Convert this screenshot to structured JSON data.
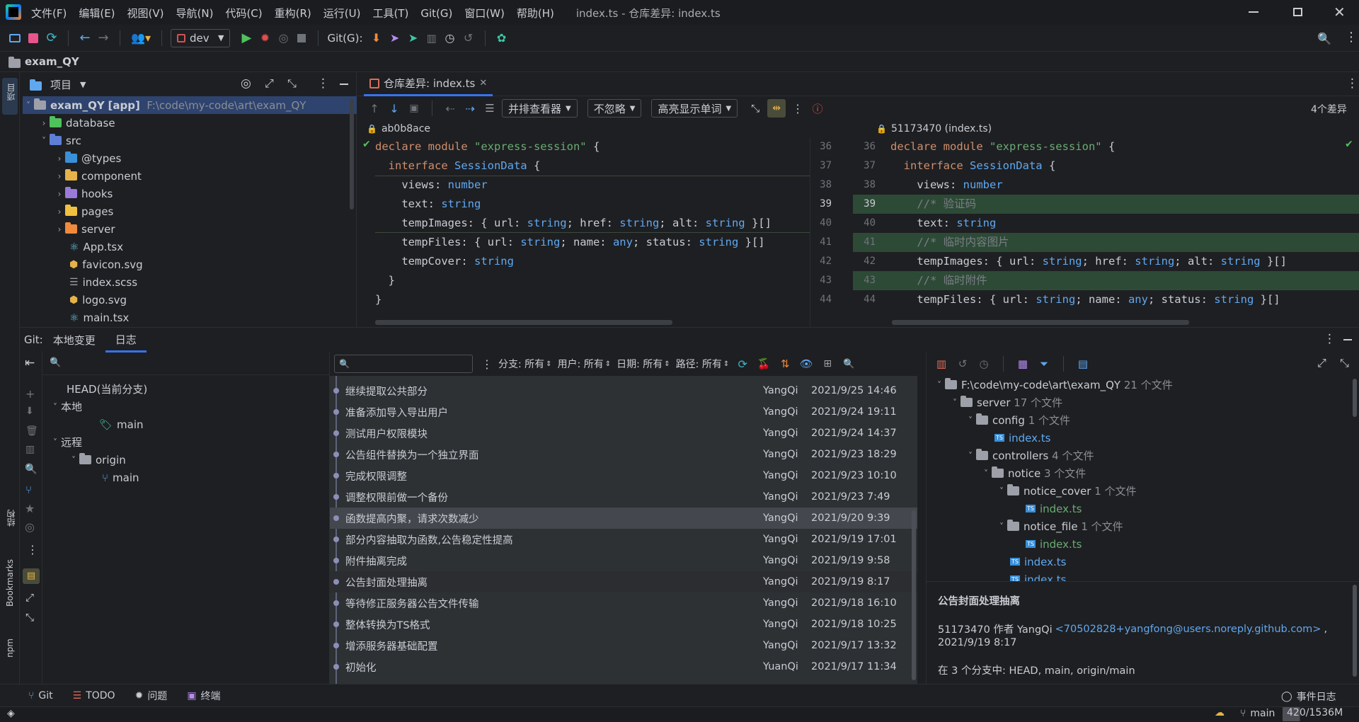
{
  "titlebar": {
    "menus": [
      "文件(F)",
      "编辑(E)",
      "视图(V)",
      "导航(N)",
      "代码(C)",
      "重构(R)",
      "运行(U)",
      "工具(T)",
      "Git(G)",
      "窗口(W)",
      "帮助(H)"
    ],
    "title": "index.ts - 仓库差异: index.ts"
  },
  "toolbar": {
    "branch": "dev",
    "git_label": "Git(G):"
  },
  "breadcrumb": {
    "project": "exam_QY"
  },
  "leftstrip": {
    "project_label": "项目",
    "structure_label": "结构",
    "bookmarks_label": "Bookmarks",
    "npm_label": "npm"
  },
  "project_panel": {
    "title": "项目",
    "root_name": "exam_QY",
    "root_tag": "[app]",
    "root_path": "F:\\code\\my-code\\art\\exam_QY",
    "items": [
      {
        "name": "database"
      },
      {
        "name": "src"
      },
      {
        "name": "@types"
      },
      {
        "name": "component"
      },
      {
        "name": "hooks"
      },
      {
        "name": "pages"
      },
      {
        "name": "server"
      },
      {
        "name": "App.tsx"
      },
      {
        "name": "favicon.svg"
      },
      {
        "name": "index.scss"
      },
      {
        "name": "logo.svg"
      },
      {
        "name": "main.tsx"
      }
    ]
  },
  "diff": {
    "tab_title": "仓库差异: index.ts",
    "viewer": "并排查看器",
    "ignore": "不忽略",
    "highlight": "高亮显示单词",
    "diff_count": "4个差异",
    "left_rev": "ab0b8ace",
    "right_rev": "51173470 (index.ts)",
    "left_lines": {
      "l1a": "declare module ",
      "l1b": "\"express-session\"",
      "l1c": " {",
      "l2a": "  interface ",
      "l2b": "SessionData",
      "l2c": " {",
      "l3a": "    views: ",
      "l3b": "number",
      "l4a": "    text: ",
      "l4b": "string",
      "l5a": "    tempImages: { url: ",
      "l5b": "string",
      "l5c": "; href: ",
      "l5d": "string",
      "l5e": "; alt: ",
      "l5f": "string",
      "l5g": " }[]",
      "l6a": "    tempFiles: { url: ",
      "l6b": "string",
      "l6c": "; name: ",
      "l6d": "any",
      "l6e": "; status: ",
      "l6f": "string",
      "l6g": " }[]",
      "l7a": "    tempCover: ",
      "l7b": "string",
      "l8": "  }",
      "l9": "}"
    },
    "right_lines": {
      "r1a": "declare module ",
      "r1b": "\"express-session\"",
      "r1c": " {",
      "r2a": "  interface ",
      "r2b": "SessionData",
      "r2c": " {",
      "r3a": "    views: ",
      "r3b": "number",
      "r4": "    //* 验证码",
      "r5a": "    text: ",
      "r5b": "string",
      "r6": "    //* 临时内容图片",
      "r7a": "    tempImages: { url: ",
      "r7b": "string",
      "r7c": "; href: ",
      "r7d": "string",
      "r7e": "; alt: ",
      "r7f": "string",
      "r7g": " }[]",
      "r8": "    //* 临时附件",
      "r9a": "    tempFiles: { url: ",
      "r9b": "string",
      "r9c": "; name: ",
      "r9d": "any",
      "r9e": "; status: ",
      "r9f": "string",
      "r9g": " }[]"
    },
    "left_nums": [
      "36",
      "37",
      "38",
      "39",
      "40",
      "41",
      "42",
      "43",
      "44"
    ],
    "right_nums": [
      "36",
      "37",
      "38",
      "39",
      "40",
      "41",
      "42",
      "43",
      "44"
    ]
  },
  "git": {
    "label": "Git:",
    "tab_local": "本地变更",
    "tab_log": "日志",
    "branches": {
      "head": "HEAD(当前分支)",
      "local": "本地",
      "local_main": "main",
      "remote": "远程",
      "origin": "origin",
      "origin_main": "main"
    },
    "filters": {
      "branch": "分支: 所有",
      "user": "用户: 所有",
      "date": "日期: 所有",
      "path": "路径: 所有"
    },
    "commits": [
      {
        "msg": "继续提取公共部分",
        "author": "YangQi",
        "date": "2021/9/25 14:46"
      },
      {
        "msg": "准备添加导入导出用户",
        "author": "YangQi",
        "date": "2021/9/24 19:11"
      },
      {
        "msg": "测试用户权限模块",
        "author": "YangQi",
        "date": "2021/9/24 14:37"
      },
      {
        "msg": "公告组件替换为一个独立界面",
        "author": "YangQi",
        "date": "2021/9/23 18:29"
      },
      {
        "msg": "完成权限调整",
        "author": "YangQi",
        "date": "2021/9/23 10:10"
      },
      {
        "msg": "调整权限前做一个备份",
        "author": "YangQi",
        "date": "2021/9/23 7:49"
      },
      {
        "msg": "函数提高内聚，请求次数减少",
        "author": "YangQi",
        "date": "2021/9/20 9:39"
      },
      {
        "msg": "部分内容抽取为函数,公告稳定性提高",
        "author": "YangQi",
        "date": "2021/9/19 17:01"
      },
      {
        "msg": "附件抽离完成",
        "author": "YangQi",
        "date": "2021/9/19 9:58"
      },
      {
        "msg": "公告封面处理抽离",
        "author": "YangQi",
        "date": "2021/9/19 8:17"
      },
      {
        "msg": "等待修正服务器公告文件传输",
        "author": "YangQi",
        "date": "2021/9/18 16:10"
      },
      {
        "msg": "整体转换为TS格式",
        "author": "YangQi",
        "date": "2021/9/18 10:25"
      },
      {
        "msg": "增添服务器基础配置",
        "author": "YangQi",
        "date": "2021/9/17 13:32"
      },
      {
        "msg": "初始化",
        "author": "YuanQi",
        "date": "2021/9/17 11:34"
      }
    ],
    "files": {
      "root": "F:\\code\\my-code\\art\\exam_QY",
      "root_count": "21 个文件",
      "server": "server",
      "server_count": "17 个文件",
      "config": "config",
      "config_count": "1 个文件",
      "config_index": "index.ts",
      "controllers": "controllers",
      "controllers_count": "4 个文件",
      "notice": "notice",
      "notice_count": "3 个文件",
      "notice_cover": "notice_cover",
      "notice_cover_count": "1 个文件",
      "nc_index": "index.ts",
      "notice_file": "notice_file",
      "notice_file_count": "1 个文件",
      "nf_index": "index.ts",
      "notice_index": "index.ts",
      "partial": "index.ts"
    },
    "details": {
      "title": "公告封面处理抽离",
      "hash_author": "51173470 作者 YangQi",
      "email": "<70502828+yangfong@users.noreply.github.com>",
      "comma": ",",
      "date": "2021/9/19 8:17",
      "branches": "在 3 个分支中: HEAD, main, origin/main"
    }
  },
  "bottomtools": {
    "git": "Git",
    "todo": "TODO",
    "problems": "问题",
    "terminal": "终端",
    "event_log": "事件日志"
  },
  "statusbar": {
    "branch": "main",
    "memory": "420/1536M"
  }
}
